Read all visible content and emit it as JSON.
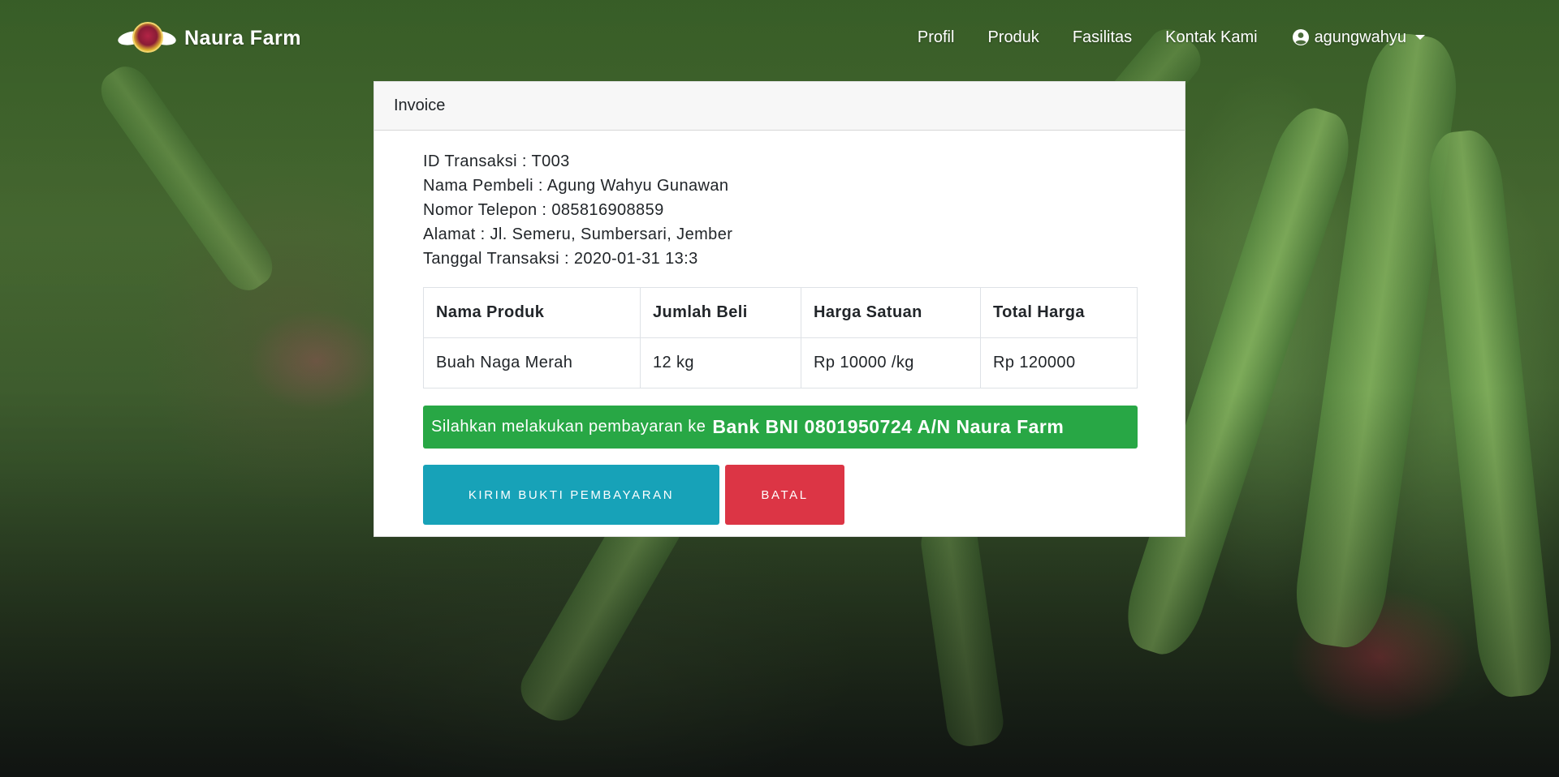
{
  "navbar": {
    "brand": "Naura Farm",
    "links": [
      "Profil",
      "Produk",
      "Fasilitas",
      "Kontak Kami"
    ],
    "user": "agungwahyu"
  },
  "invoice": {
    "header": "Invoice",
    "info": [
      "ID Transaksi : T003",
      "Nama Pembeli : Agung Wahyu Gunawan",
      "Nomor Telepon : 085816908859",
      "Alamat : Jl. Semeru, Sumbersari, Jember",
      "Tanggal Transaksi : 2020-01-31 13:3"
    ],
    "table": {
      "headers": [
        "Nama Produk",
        "Jumlah Beli",
        "Harga Satuan",
        "Total Harga"
      ],
      "rows": [
        [
          "Buah Naga Merah",
          "12 kg",
          "Rp 10000 /kg",
          "Rp 120000"
        ]
      ]
    },
    "payment_note": "Silahkan melakukan pembayaran ke",
    "payment_bank": "Bank BNI 0801950724 A/N Naura Farm",
    "buttons": {
      "send_proof": "KIRIM BUKTI PEMBAYARAN",
      "cancel": "BATAL"
    }
  },
  "colors": {
    "success": "#28a745",
    "info": "#17a2b8",
    "danger": "#dc3545",
    "header_bg": "#f7f7f7"
  },
  "icons": {
    "user": "user-circle-icon",
    "dropdown": "caret-down-icon"
  }
}
